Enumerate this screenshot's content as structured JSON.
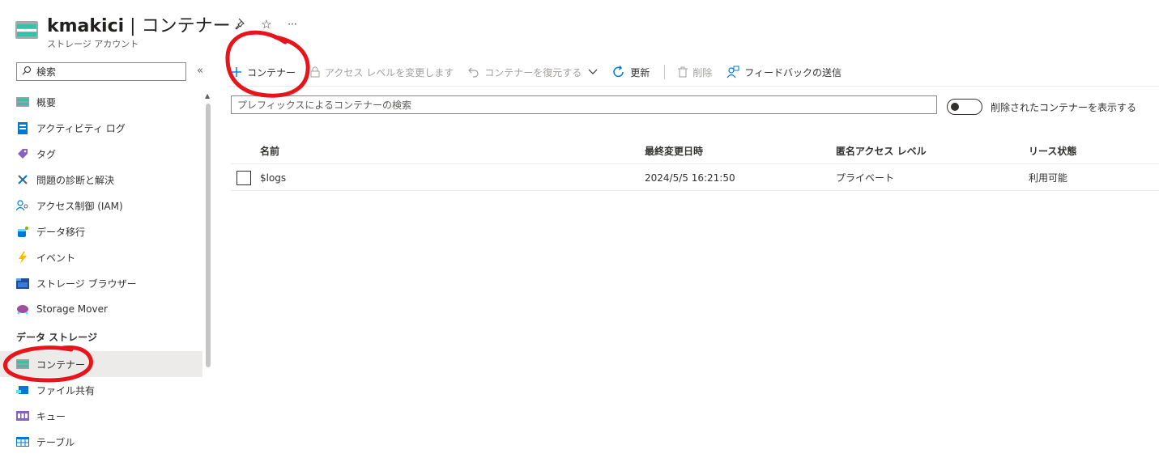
{
  "header": {
    "resource_name": "kmakici",
    "separator": " | ",
    "page_name": "コンテナー",
    "subtitle": "ストレージ アカウント",
    "actions": [
      {
        "icon": "pin-icon",
        "glyph": "📌"
      },
      {
        "icon": "star-icon",
        "glyph": "☆"
      },
      {
        "icon": "more-icon",
        "glyph": "···"
      }
    ]
  },
  "sidebar": {
    "search_placeholder": "検索",
    "collapse_glyph": "«",
    "items": [
      {
        "label": "概要",
        "icon": "overview-icon"
      },
      {
        "label": "アクティビティ ログ",
        "icon": "activity-log-icon"
      },
      {
        "label": "タグ",
        "icon": "tag-icon"
      },
      {
        "label": "問題の診断と解決",
        "icon": "diagnose-icon"
      },
      {
        "label": "アクセス制御 (IAM)",
        "icon": "iam-icon"
      },
      {
        "label": "データ移行",
        "icon": "data-migration-icon"
      },
      {
        "label": "イベント",
        "icon": "events-icon"
      },
      {
        "label": "ストレージ ブラウザー",
        "icon": "storage-browser-icon"
      },
      {
        "label": "Storage Mover",
        "icon": "storage-mover-icon"
      }
    ],
    "section_label": "データ ストレージ",
    "section_items": [
      {
        "label": "コンテナー",
        "icon": "container-icon",
        "selected": true
      },
      {
        "label": "ファイル共有",
        "icon": "file-share-icon"
      },
      {
        "label": "キュー",
        "icon": "queue-icon"
      },
      {
        "label": "テーブル",
        "icon": "table-icon"
      }
    ]
  },
  "toolbar": {
    "add_container": "コンテナー",
    "change_access": "アクセス レベルを変更します",
    "restore": "コンテナーを復元する",
    "refresh": "更新",
    "delete": "削除",
    "feedback": "フィードバックの送信"
  },
  "filter": {
    "placeholder": "プレフィックスによるコンテナーの検索",
    "toggle_label": "削除されたコンテナーを表示する"
  },
  "table": {
    "columns": [
      "名前",
      "最終変更日時",
      "匿名アクセス レベル",
      "リース状態"
    ],
    "rows": [
      {
        "name": "$logs",
        "modified": "2024/5/5 16:21:50",
        "access": "プライベート",
        "lease": "利用可能"
      }
    ]
  },
  "colors": {
    "accent": "#0078d4",
    "annotation": "#e8141b",
    "selected_bg": "#edebe9"
  }
}
